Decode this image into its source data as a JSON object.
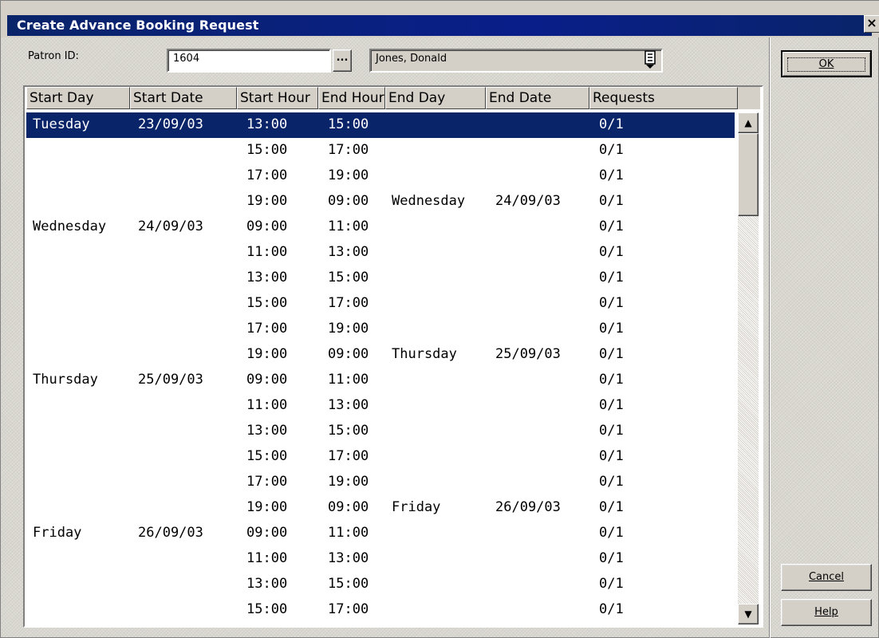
{
  "window": {
    "title": "Create Advance Booking Request",
    "close_glyph": "×"
  },
  "patron": {
    "label": "Patron ID:",
    "id_value": "1604",
    "lookup_glyph": "...",
    "name_value": "Jones, Donald",
    "dropdown_icon": "list-dropdown-icon"
  },
  "buttons": {
    "ok": "OK",
    "cancel": "Cancel",
    "help": "Help"
  },
  "grid": {
    "columns": [
      "Start Day",
      "Start Date",
      "Start Hour",
      "End Hour",
      "End Day",
      "End Date",
      "Requests"
    ],
    "selected_row": 0,
    "rows": [
      [
        "Tuesday",
        "23/09/03",
        "13:00",
        "15:00",
        "",
        "",
        "0/1"
      ],
      [
        "",
        "",
        "15:00",
        "17:00",
        "",
        "",
        "0/1"
      ],
      [
        "",
        "",
        "17:00",
        "19:00",
        "",
        "",
        "0/1"
      ],
      [
        "",
        "",
        "19:00",
        "09:00",
        "Wednesday",
        "24/09/03",
        "0/1"
      ],
      [
        "Wednesday",
        "24/09/03",
        "09:00",
        "11:00",
        "",
        "",
        "0/1"
      ],
      [
        "",
        "",
        "11:00",
        "13:00",
        "",
        "",
        "0/1"
      ],
      [
        "",
        "",
        "13:00",
        "15:00",
        "",
        "",
        "0/1"
      ],
      [
        "",
        "",
        "15:00",
        "17:00",
        "",
        "",
        "0/1"
      ],
      [
        "",
        "",
        "17:00",
        "19:00",
        "",
        "",
        "0/1"
      ],
      [
        "",
        "",
        "19:00",
        "09:00",
        "Thursday",
        "25/09/03",
        "0/1"
      ],
      [
        "Thursday",
        "25/09/03",
        "09:00",
        "11:00",
        "",
        "",
        "0/1"
      ],
      [
        "",
        "",
        "11:00",
        "13:00",
        "",
        "",
        "0/1"
      ],
      [
        "",
        "",
        "13:00",
        "15:00",
        "",
        "",
        "0/1"
      ],
      [
        "",
        "",
        "15:00",
        "17:00",
        "",
        "",
        "0/1"
      ],
      [
        "",
        "",
        "17:00",
        "19:00",
        "",
        "",
        "0/1"
      ],
      [
        "",
        "",
        "19:00",
        "09:00",
        "Friday",
        "26/09/03",
        "0/1"
      ],
      [
        "Friday",
        "26/09/03",
        "09:00",
        "11:00",
        "",
        "",
        "0/1"
      ],
      [
        "",
        "",
        "11:00",
        "13:00",
        "",
        "",
        "0/1"
      ],
      [
        "",
        "",
        "13:00",
        "15:00",
        "",
        "",
        "0/1"
      ],
      [
        "",
        "",
        "15:00",
        "17:00",
        "",
        "",
        "0/1"
      ]
    ],
    "scroll_up_glyph": "▲",
    "scroll_down_glyph": "▼"
  }
}
